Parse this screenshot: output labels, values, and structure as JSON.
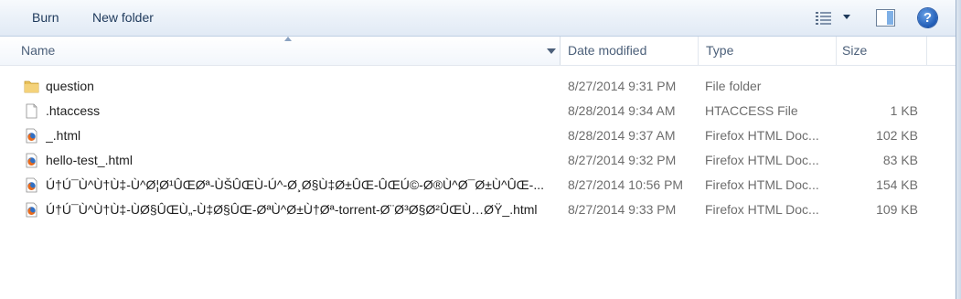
{
  "toolbar": {
    "burn_label": "Burn",
    "new_folder_label": "New folder"
  },
  "columns": {
    "name": "Name",
    "date": "Date modified",
    "type": "Type",
    "size": "Size"
  },
  "files": [
    {
      "icon": "folder-icon",
      "name": "question",
      "date": "8/27/2014 9:31 PM",
      "type": "File folder",
      "size": ""
    },
    {
      "icon": "blank-file-icon",
      "name": ".htaccess",
      "date": "8/28/2014 9:34 AM",
      "type": "HTACCESS File",
      "size": "1 KB"
    },
    {
      "icon": "firefox-icon",
      "name": "_.html",
      "date": "8/28/2014 9:37 AM",
      "type": "Firefox HTML Doc...",
      "size": "102 KB"
    },
    {
      "icon": "firefox-icon",
      "name": "hello-test_.html",
      "date": "8/27/2014 9:32 PM",
      "type": "Firefox HTML Doc...",
      "size": "83 KB"
    },
    {
      "icon": "firefox-icon",
      "name": "Ú†Ú¯Ù^Ù†Ù‡-Ù^Ø¦Ø¹ÛŒØª-ÙŠÛŒÙ-Ú^-Ø¸Ø§Ù‡Ø±ÛŒ-ÛŒÚ©-Ø®Ù^Ø¯Ø±Ù^ÛŒ-...",
      "date": "8/27/2014 10:56 PM",
      "type": "Firefox HTML Doc...",
      "size": "154 KB"
    },
    {
      "icon": "firefox-icon",
      "name": "Ú†Ú¯Ù^Ù†Ù‡-ÙØ§ÛŒÙ„-Ù‡Ø§ÛŒ-ØªÙ^Ø±Ù†Øª-torrent-Ø¨Ø³Ø§Ø²ÛŒÙ…ØŸ_.html",
      "date": "8/27/2014 9:33 PM",
      "type": "Firefox HTML Doc...",
      "size": "109 KB"
    }
  ],
  "colors": {
    "toolbar_top": "#f7fafd",
    "toolbar_bottom": "#e1eaf5",
    "header_text": "#4c607a",
    "meta_text": "#6d6d6d",
    "folder": "#e8c15a",
    "help": "#1f5bb5"
  }
}
